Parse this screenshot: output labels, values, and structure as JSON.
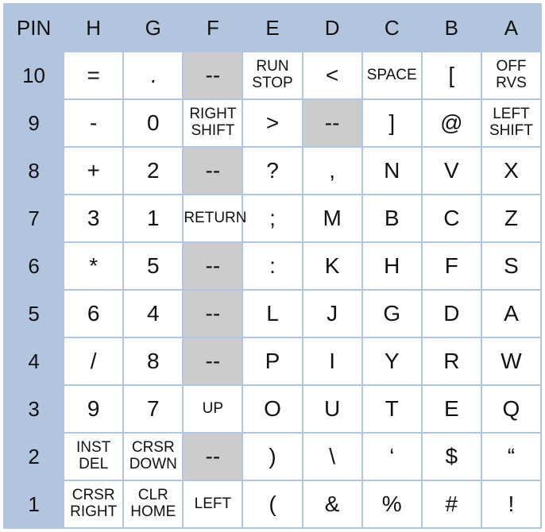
{
  "headers": [
    "PIN",
    "H",
    "G",
    "F",
    "E",
    "D",
    "C",
    "B",
    "A"
  ],
  "rows": [
    {
      "pin": "10",
      "cells": [
        {
          "t": "=",
          "gray": false,
          "small": false
        },
        {
          "t": ".",
          "gray": false,
          "small": false
        },
        {
          "t": "--",
          "gray": true,
          "small": false
        },
        {
          "t": "RUN\nSTOP",
          "gray": false,
          "small": true
        },
        {
          "t": "<",
          "gray": false,
          "small": false
        },
        {
          "t": "SPACE",
          "gray": false,
          "small": true
        },
        {
          "t": "[",
          "gray": false,
          "small": false
        },
        {
          "t": "OFF\nRVS",
          "gray": false,
          "small": true
        }
      ]
    },
    {
      "pin": "9",
      "cells": [
        {
          "t": "-",
          "gray": false,
          "small": false
        },
        {
          "t": "0",
          "gray": false,
          "small": false
        },
        {
          "t": "RIGHT\nSHIFT",
          "gray": false,
          "small": true
        },
        {
          "t": ">",
          "gray": false,
          "small": false
        },
        {
          "t": "--",
          "gray": true,
          "small": false
        },
        {
          "t": "]",
          "gray": false,
          "small": false
        },
        {
          "t": "@",
          "gray": false,
          "small": false
        },
        {
          "t": "LEFT\nSHIFT",
          "gray": false,
          "small": true
        }
      ]
    },
    {
      "pin": "8",
      "cells": [
        {
          "t": "+",
          "gray": false,
          "small": false
        },
        {
          "t": "2",
          "gray": false,
          "small": false
        },
        {
          "t": "--",
          "gray": true,
          "small": false
        },
        {
          "t": "?",
          "gray": false,
          "small": false
        },
        {
          "t": ",",
          "gray": false,
          "small": false
        },
        {
          "t": "N",
          "gray": false,
          "small": false
        },
        {
          "t": "V",
          "gray": false,
          "small": false
        },
        {
          "t": "X",
          "gray": false,
          "small": false
        }
      ]
    },
    {
      "pin": "7",
      "cells": [
        {
          "t": "3",
          "gray": false,
          "small": false
        },
        {
          "t": "1",
          "gray": false,
          "small": false
        },
        {
          "t": "RETURN",
          "gray": false,
          "small": true
        },
        {
          "t": ";",
          "gray": false,
          "small": false
        },
        {
          "t": "M",
          "gray": false,
          "small": false
        },
        {
          "t": "B",
          "gray": false,
          "small": false
        },
        {
          "t": "C",
          "gray": false,
          "small": false
        },
        {
          "t": "Z",
          "gray": false,
          "small": false
        }
      ]
    },
    {
      "pin": "6",
      "cells": [
        {
          "t": "*",
          "gray": false,
          "small": false
        },
        {
          "t": "5",
          "gray": false,
          "small": false
        },
        {
          "t": "--",
          "gray": true,
          "small": false
        },
        {
          "t": ":",
          "gray": false,
          "small": false
        },
        {
          "t": "K",
          "gray": false,
          "small": false
        },
        {
          "t": "H",
          "gray": false,
          "small": false
        },
        {
          "t": "F",
          "gray": false,
          "small": false
        },
        {
          "t": "S",
          "gray": false,
          "small": false
        }
      ]
    },
    {
      "pin": "5",
      "cells": [
        {
          "t": "6",
          "gray": false,
          "small": false
        },
        {
          "t": "4",
          "gray": false,
          "small": false
        },
        {
          "t": "--",
          "gray": true,
          "small": false
        },
        {
          "t": "L",
          "gray": false,
          "small": false
        },
        {
          "t": "J",
          "gray": false,
          "small": false
        },
        {
          "t": "G",
          "gray": false,
          "small": false
        },
        {
          "t": "D",
          "gray": false,
          "small": false
        },
        {
          "t": "A",
          "gray": false,
          "small": false
        }
      ]
    },
    {
      "pin": "4",
      "cells": [
        {
          "t": "/",
          "gray": false,
          "small": false
        },
        {
          "t": "8",
          "gray": false,
          "small": false
        },
        {
          "t": "--",
          "gray": true,
          "small": false
        },
        {
          "t": "P",
          "gray": false,
          "small": false
        },
        {
          "t": "I",
          "gray": false,
          "small": false
        },
        {
          "t": "Y",
          "gray": false,
          "small": false
        },
        {
          "t": "R",
          "gray": false,
          "small": false
        },
        {
          "t": "W",
          "gray": false,
          "small": false
        }
      ]
    },
    {
      "pin": "3",
      "cells": [
        {
          "t": "9",
          "gray": false,
          "small": false
        },
        {
          "t": "7",
          "gray": false,
          "small": false
        },
        {
          "t": "UP",
          "gray": false,
          "small": true
        },
        {
          "t": "O",
          "gray": false,
          "small": false
        },
        {
          "t": "U",
          "gray": false,
          "small": false
        },
        {
          "t": "T",
          "gray": false,
          "small": false
        },
        {
          "t": "E",
          "gray": false,
          "small": false
        },
        {
          "t": "Q",
          "gray": false,
          "small": false
        }
      ]
    },
    {
      "pin": "2",
      "cells": [
        {
          "t": "INST\nDEL",
          "gray": false,
          "small": true
        },
        {
          "t": "CRSR\nDOWN",
          "gray": false,
          "small": true
        },
        {
          "t": "--",
          "gray": true,
          "small": false
        },
        {
          "t": ")",
          "gray": false,
          "small": false
        },
        {
          "t": "\\",
          "gray": false,
          "small": false
        },
        {
          "t": "‘",
          "gray": false,
          "small": false
        },
        {
          "t": "$",
          "gray": false,
          "small": false
        },
        {
          "t": "“",
          "gray": false,
          "small": false
        }
      ]
    },
    {
      "pin": "1",
      "cells": [
        {
          "t": "CRSR\nRIGHT",
          "gray": false,
          "small": true
        },
        {
          "t": "CLR\nHOME",
          "gray": false,
          "small": true
        },
        {
          "t": "LEFT",
          "gray": false,
          "small": true
        },
        {
          "t": "(",
          "gray": false,
          "small": false
        },
        {
          "t": "&",
          "gray": false,
          "small": false
        },
        {
          "t": "%",
          "gray": false,
          "small": false
        },
        {
          "t": "#",
          "gray": false,
          "small": false
        },
        {
          "t": "!",
          "gray": false,
          "small": false
        }
      ]
    }
  ]
}
